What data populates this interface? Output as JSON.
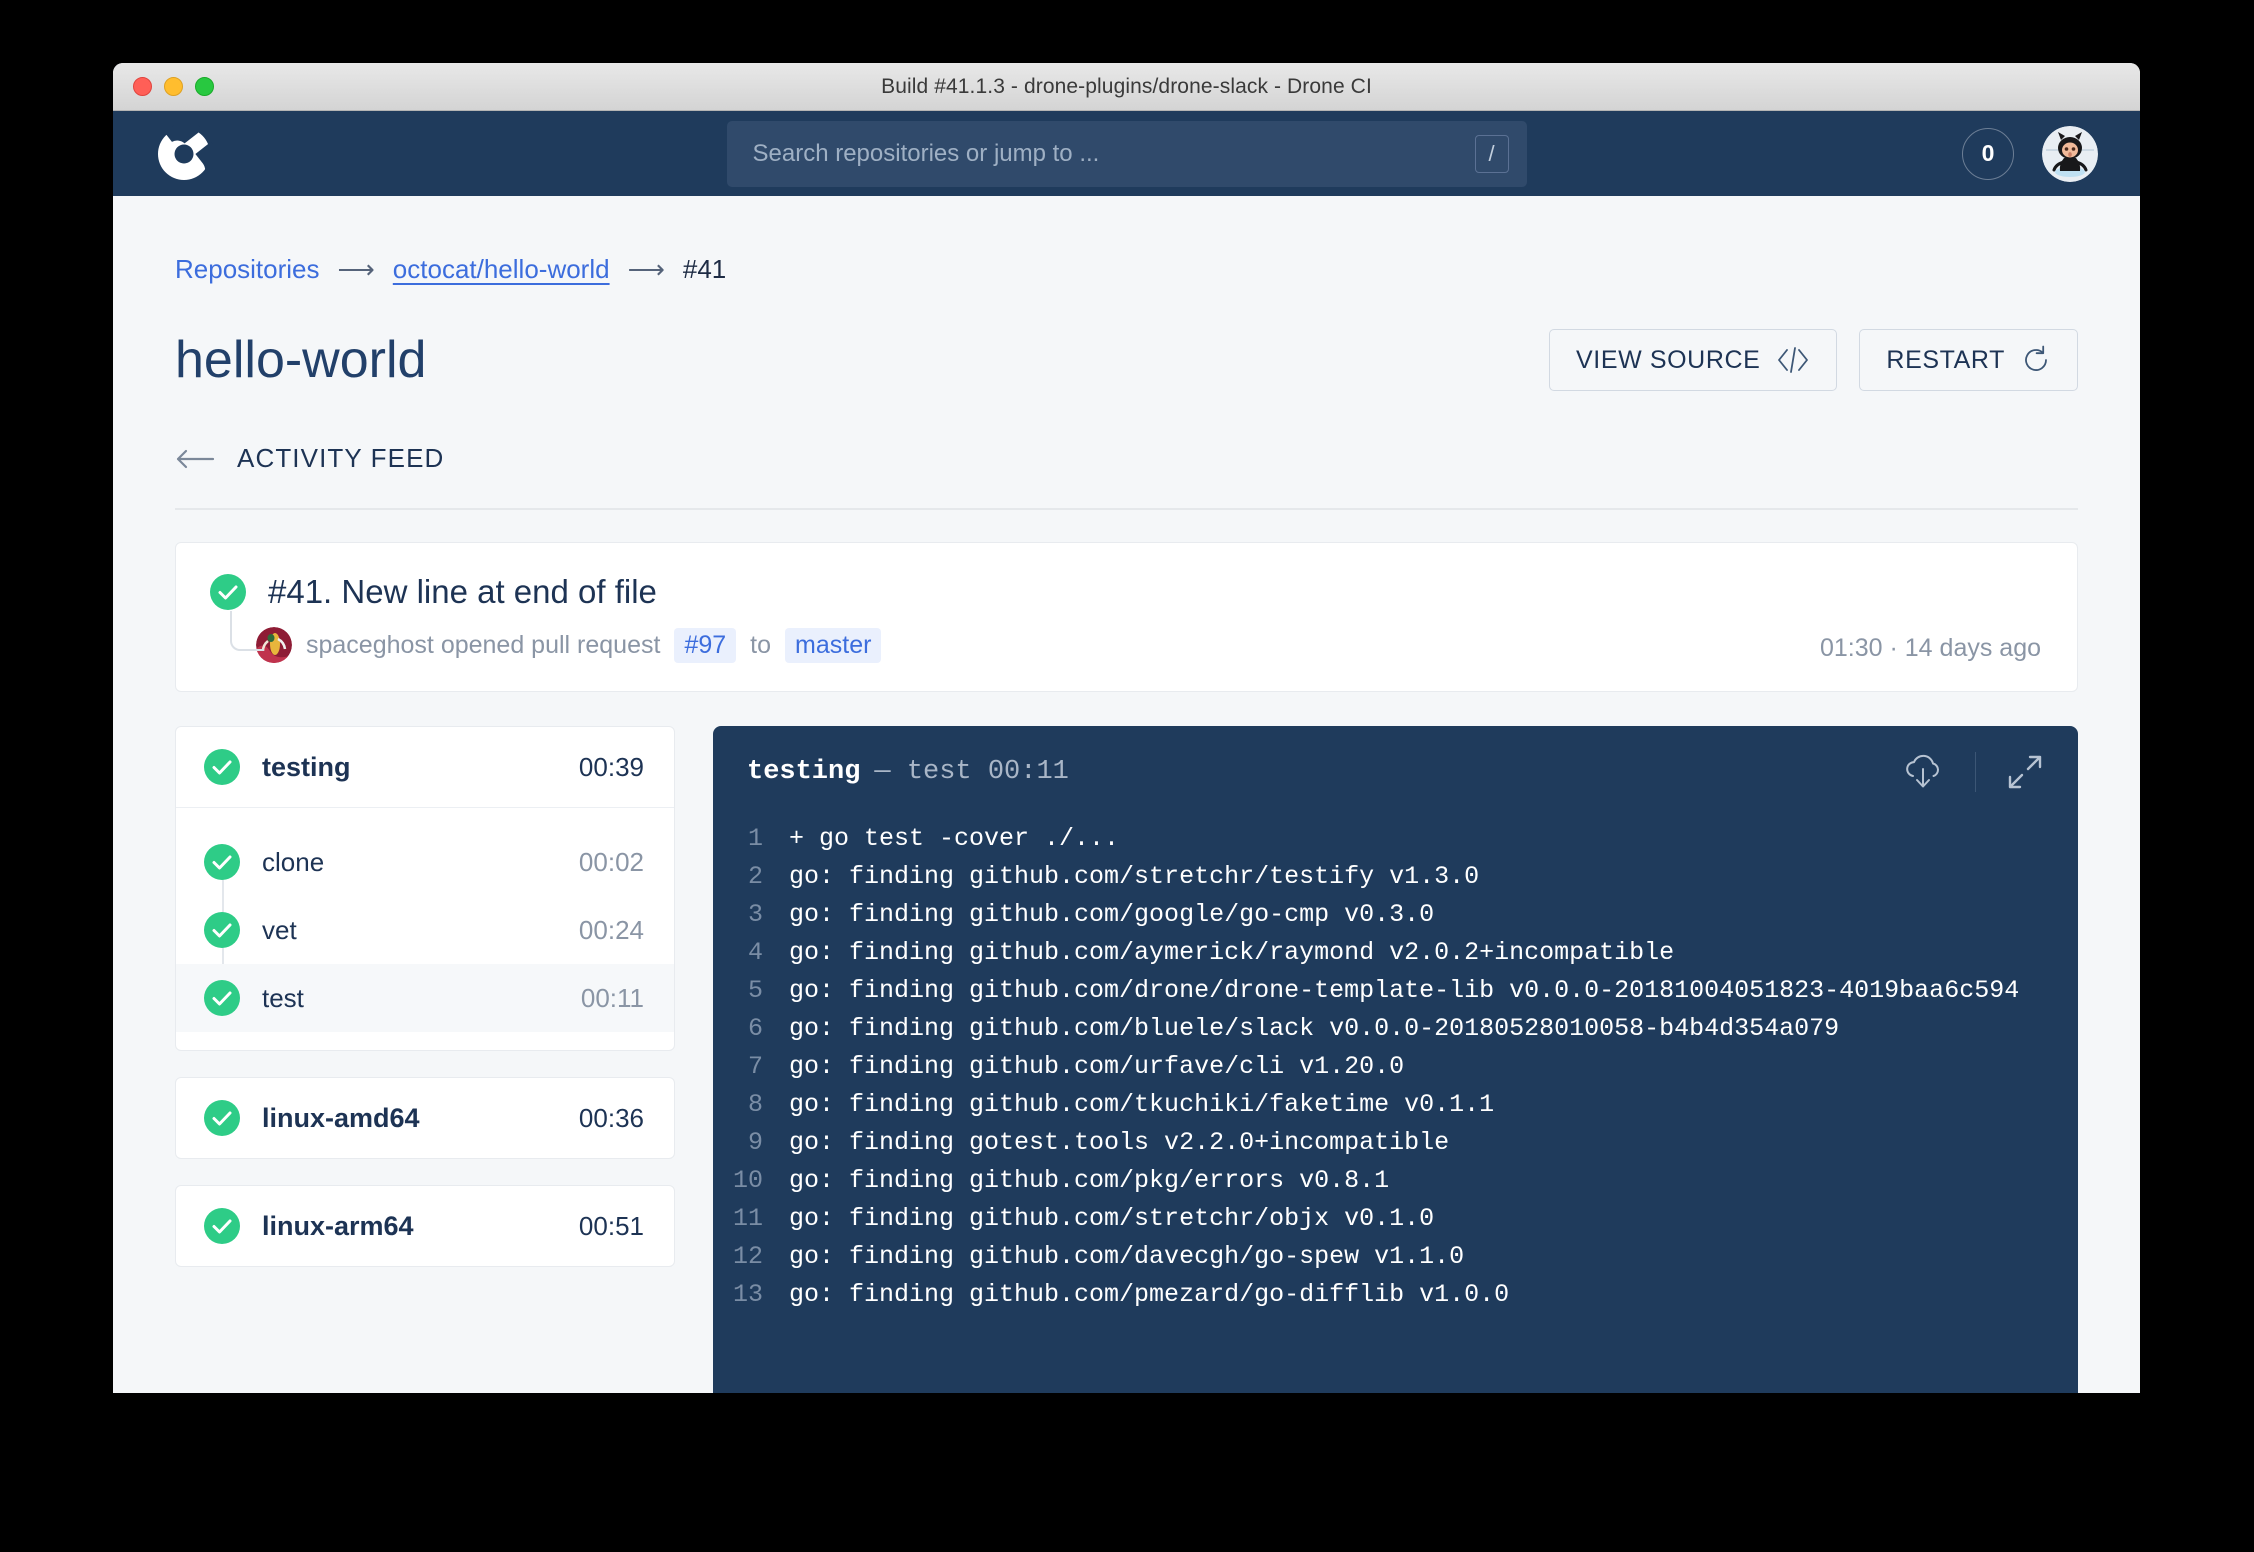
{
  "window": {
    "title": "Build #41.1.3 - drone-plugins/drone-slack - Drone CI"
  },
  "topnav": {
    "logo_icon": "drone-logo-icon",
    "search": {
      "placeholder": "Search repositories or jump to ...",
      "value": "",
      "shortcut_key": "/"
    },
    "notification_count": "0",
    "avatar_icon": "octocat-avatar"
  },
  "breadcrumb": {
    "repositories": "Repositories",
    "repo": "octocat/hello-world",
    "build": "#41",
    "separator": "⟶"
  },
  "header": {
    "repo_title": "hello-world",
    "view_source_label": "VIEW SOURCE",
    "restart_label": "RESTART",
    "activity_feed_label": "ACTIVITY FEED"
  },
  "build": {
    "status": "success",
    "title": "#41. New line at end of file",
    "author": "spaceghost",
    "action_text": "opened pull request",
    "pull_request": "#97",
    "to_label": "to",
    "branch": "master",
    "time": "01:30",
    "time_separator": "·",
    "relative_time": "14 days ago",
    "summary_line": "spaceghost opened pull request"
  },
  "stages": [
    {
      "name": "testing",
      "duration": "00:39",
      "status": "success",
      "steps": [
        {
          "name": "clone",
          "duration": "00:02",
          "status": "success",
          "active": false
        },
        {
          "name": "vet",
          "duration": "00:24",
          "status": "success",
          "active": false
        },
        {
          "name": "test",
          "duration": "00:11",
          "status": "success",
          "active": true
        }
      ]
    },
    {
      "name": "linux-amd64",
      "duration": "00:36",
      "status": "success",
      "steps": []
    },
    {
      "name": "linux-arm64",
      "duration": "00:51",
      "status": "success",
      "steps": []
    }
  ],
  "log": {
    "stage_name": "testing",
    "dash": "—",
    "step_name": "test",
    "duration": "00:11",
    "download_icon": "cloud-download-icon",
    "expand_icon": "expand-icon",
    "lines": [
      {
        "n": "1",
        "text": "+ go test -cover ./..."
      },
      {
        "n": "2",
        "text": "go: finding github.com/stretchr/testify v1.3.0"
      },
      {
        "n": "3",
        "text": "go: finding github.com/google/go-cmp v0.3.0"
      },
      {
        "n": "4",
        "text": "go: finding github.com/aymerick/raymond v2.0.2+incompatible"
      },
      {
        "n": "5",
        "text": "go: finding github.com/drone/drone-template-lib v0.0.0-20181004051823-4019baa6c594"
      },
      {
        "n": "6",
        "text": "go: finding github.com/bluele/slack v0.0.0-20180528010058-b4b4d354a079"
      },
      {
        "n": "7",
        "text": "go: finding github.com/urfave/cli v1.20.0"
      },
      {
        "n": "8",
        "text": "go: finding github.com/tkuchiki/faketime v0.1.1"
      },
      {
        "n": "9",
        "text": "go: finding gotest.tools v2.2.0+incompatible"
      },
      {
        "n": "10",
        "text": "go: finding github.com/pkg/errors v0.8.1"
      },
      {
        "n": "11",
        "text": "go: finding github.com/stretchr/objx v0.1.0"
      },
      {
        "n": "12",
        "text": "go: finding github.com/davecgh/go-spew v1.1.0"
      },
      {
        "n": "13",
        "text": "go: finding github.com/pmezard/go-difflib v1.0.0"
      }
    ]
  },
  "colors": {
    "nav_bg": "#1f3b5c",
    "page_bg": "#f5f7f9",
    "success_green": "#2ecc87",
    "link_blue": "#3c6ddd",
    "text_dark": "#1d3354",
    "text_muted": "#8a95a5"
  }
}
